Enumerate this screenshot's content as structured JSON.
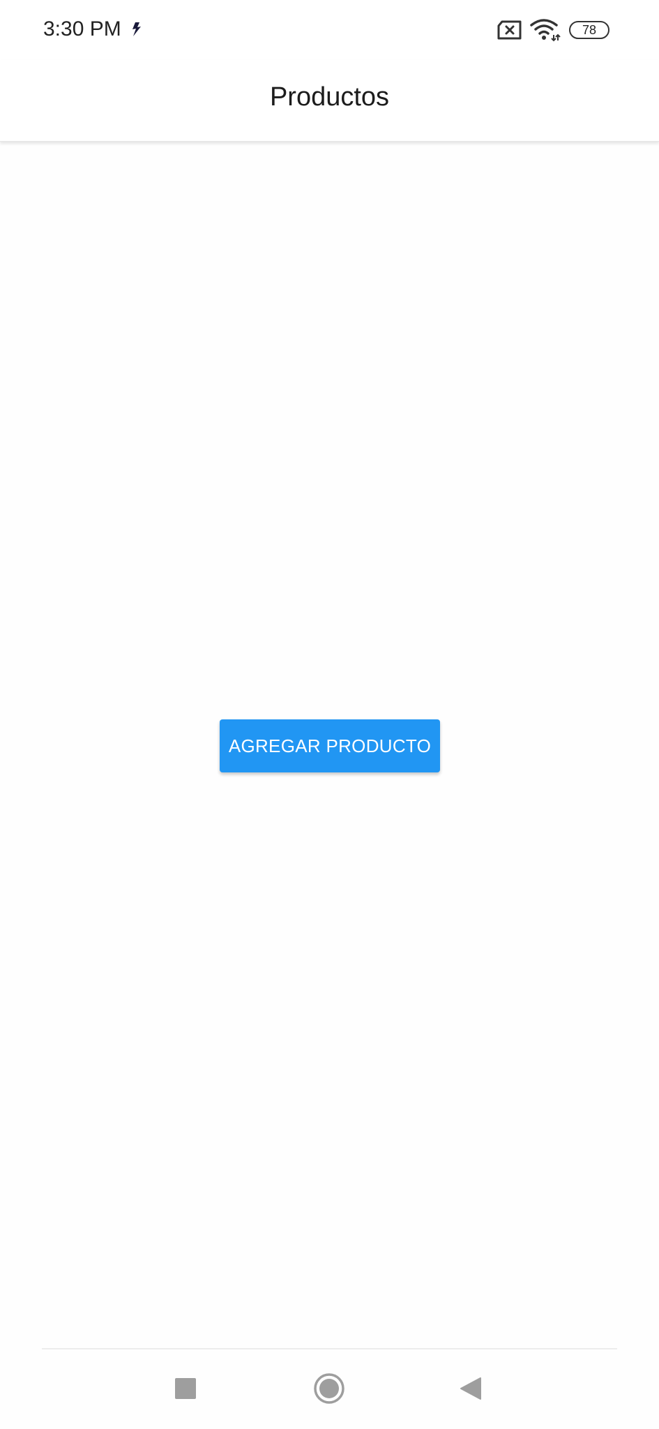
{
  "status_bar": {
    "time": "3:30 PM",
    "battery_level": "78",
    "icons": [
      "app-notification-icon",
      "sim-missing-icon",
      "wifi-icon",
      "battery-icon"
    ]
  },
  "app_bar": {
    "title": "Productos"
  },
  "main": {
    "add_button_label": "AGREGAR PRODUCTO"
  },
  "nav_bar": {
    "icons": [
      "recents-square-icon",
      "home-circle-icon",
      "back-triangle-icon"
    ]
  },
  "colors": {
    "accent": "#2196f3",
    "background": "#fefefe"
  }
}
